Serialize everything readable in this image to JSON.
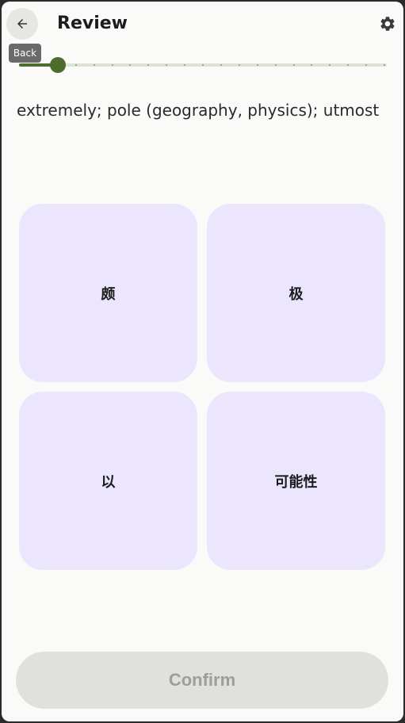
{
  "header": {
    "title": "Review",
    "back_tooltip": "Back",
    "back_icon": "arrow-left-icon",
    "settings_icon": "gear-icon"
  },
  "progress": {
    "value": 0.1,
    "steps": 21
  },
  "prompt": {
    "text": "extremely; pole (geography, physics); utmost"
  },
  "options": [
    {
      "label": "颇"
    },
    {
      "label": "极"
    },
    {
      "label": "以"
    },
    {
      "label": "可能性"
    }
  ],
  "confirm": {
    "label": "Confirm",
    "enabled": false
  },
  "colors": {
    "accent": "#4e6c2c",
    "option_bg": "#ebe6fe",
    "background": "#fafaf8",
    "button_disabled_bg": "#e0e0dd",
    "button_disabled_text": "#9d9d9a"
  }
}
